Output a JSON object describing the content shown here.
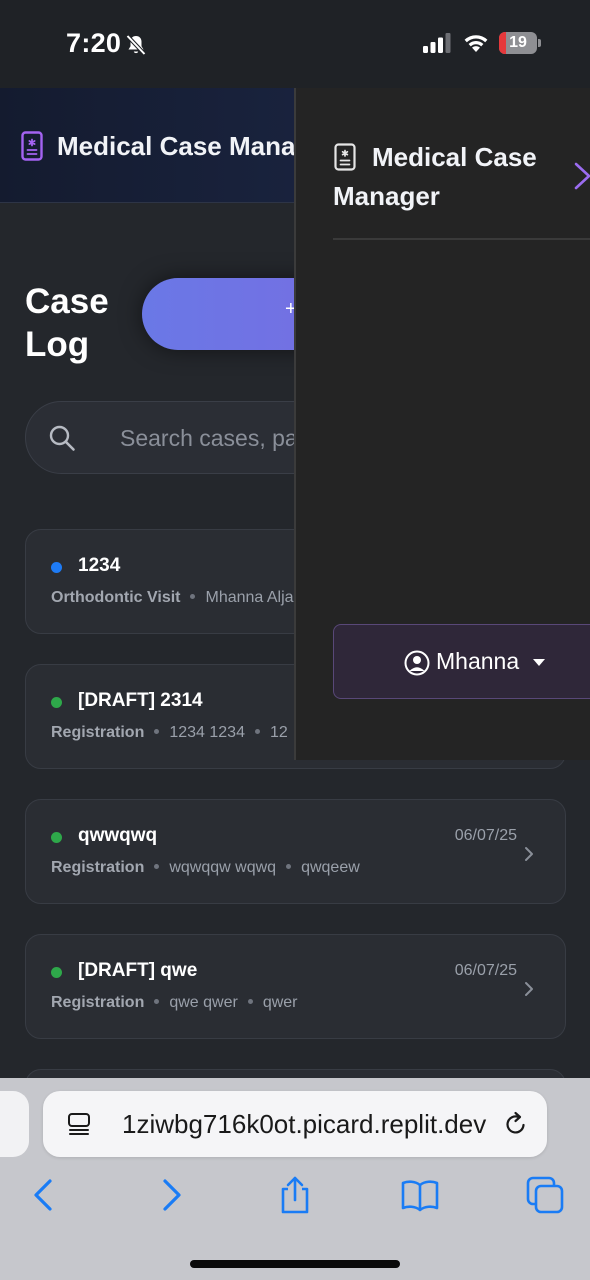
{
  "status_bar": {
    "time": "7:20",
    "battery_level": "19",
    "battery_fraction": 0.19,
    "icons": [
      "bell-slash-icon",
      "signal-icon",
      "wifi-icon",
      "battery-icon"
    ]
  },
  "app": {
    "title": "Medical Case Manager",
    "header_icon": "medical-file-icon"
  },
  "page": {
    "title": "Case Log",
    "new_case_label": "+",
    "search_placeholder": "Search cases, pa"
  },
  "cases": [
    {
      "status": "blue",
      "title": "1234",
      "date": "",
      "type": "Orthodontic Visit",
      "meta": [
        "Mhanna Alja"
      ]
    },
    {
      "status": "green",
      "title": "[DRAFT] 2314",
      "date": "",
      "type": "Registration",
      "meta": [
        "1234 1234",
        "12"
      ]
    },
    {
      "status": "green",
      "title": "qwwqwq",
      "date": "06/07/25",
      "type": "Registration",
      "meta": [
        "wqwqqw wqwq",
        "qwqeew"
      ]
    },
    {
      "status": "green",
      "title": "[DRAFT] qwe",
      "date": "06/07/25",
      "type": "Registration",
      "meta": [
        "qwe qwer",
        "qwer"
      ]
    }
  ],
  "drawer": {
    "title": "Medical Case Manager",
    "user_name": "Mhanna",
    "close_icon": "chevron-right-icon"
  },
  "browser": {
    "url": "1ziwbg716k0ot.picard.replit.dev",
    "toolbar": [
      "back-icon",
      "forward-icon",
      "share-icon",
      "bookmarks-icon",
      "tabs-icon"
    ]
  },
  "colors": {
    "accent_purple": "#8b5cf6",
    "status_blue": "#1e7bf5",
    "status_green": "#2ea84a",
    "button_gradient_start": "#6a78e6",
    "safari_blue": "#1a7cf5"
  }
}
